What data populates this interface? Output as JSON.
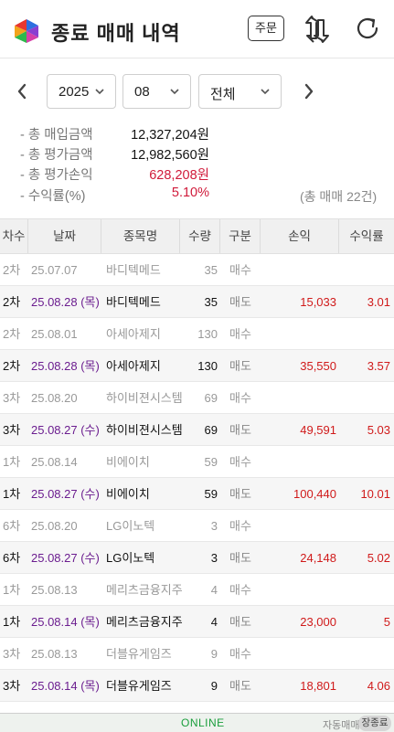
{
  "header": {
    "title": "종료 매매 내역",
    "order_label": "주문",
    "icons": {
      "logo": "app-logo",
      "swap": "swap-arrows-icon",
      "refresh": "refresh-icon"
    },
    "logo_colors": [
      "#e8372f",
      "#2d6fe0",
      "#8a3fd1",
      "#2db84c"
    ]
  },
  "filters": {
    "year": "2025",
    "month": "08",
    "type": "전체"
  },
  "summary": {
    "buy_total_label": "- 총 매입금액",
    "buy_total_value": "12,327,204원",
    "eval_total_label": "- 총 평가금액",
    "eval_total_value": "12,982,560원",
    "pl_total_label": "- 총 평가손익",
    "pl_total_value": "628,208원",
    "return_label": "- 수익률(%)",
    "return_value": "5.10%",
    "trade_count": "(총 매매 22건)"
  },
  "table": {
    "headers": [
      "차수",
      "날짜",
      "종목명",
      "수량",
      "구분",
      "손익",
      "수익률"
    ],
    "rows": [
      {
        "kind": "buy",
        "cha": "2차",
        "date": "25.07.07",
        "name": "바디텍메드",
        "qty": "35",
        "type": "매수",
        "pl": "",
        "rate": ""
      },
      {
        "kind": "sell",
        "cha": "2차",
        "date": "25.08.28 (목)",
        "name": "바디텍메드",
        "qty": "35",
        "type": "매도",
        "pl": "15,033",
        "rate": "3.01"
      },
      {
        "kind": "buy",
        "cha": "2차",
        "date": "25.08.01",
        "name": "아세아제지",
        "qty": "130",
        "type": "매수",
        "pl": "",
        "rate": ""
      },
      {
        "kind": "sell",
        "cha": "2차",
        "date": "25.08.28 (목)",
        "name": "아세아제지",
        "qty": "130",
        "type": "매도",
        "pl": "35,550",
        "rate": "3.57"
      },
      {
        "kind": "buy",
        "cha": "3차",
        "date": "25.08.20",
        "name": "하이비젼시스템",
        "qty": "69",
        "type": "매수",
        "pl": "",
        "rate": ""
      },
      {
        "kind": "sell",
        "cha": "3차",
        "date": "25.08.27 (수)",
        "name": "하이비젼시스템",
        "qty": "69",
        "type": "매도",
        "pl": "49,591",
        "rate": "5.03"
      },
      {
        "kind": "buy",
        "cha": "1차",
        "date": "25.08.14",
        "name": "비에이치",
        "qty": "59",
        "type": "매수",
        "pl": "",
        "rate": ""
      },
      {
        "kind": "sell",
        "cha": "1차",
        "date": "25.08.27 (수)",
        "name": "비에이치",
        "qty": "59",
        "type": "매도",
        "pl": "100,440",
        "rate": "10.01"
      },
      {
        "kind": "buy",
        "cha": "6차",
        "date": "25.08.20",
        "name": "LG이노텍",
        "qty": "3",
        "type": "매수",
        "pl": "",
        "rate": ""
      },
      {
        "kind": "sell",
        "cha": "6차",
        "date": "25.08.27 (수)",
        "name": "LG이노텍",
        "qty": "3",
        "type": "매도",
        "pl": "24,148",
        "rate": "5.02"
      },
      {
        "kind": "buy",
        "cha": "1차",
        "date": "25.08.13",
        "name": "메리츠금융지주",
        "qty": "4",
        "type": "매수",
        "pl": "",
        "rate": ""
      },
      {
        "kind": "sell",
        "cha": "1차",
        "date": "25.08.14 (목)",
        "name": "메리츠금융지주",
        "qty": "4",
        "type": "매도",
        "pl": "23,000",
        "rate": "5"
      },
      {
        "kind": "buy",
        "cha": "3차",
        "date": "25.08.13",
        "name": "더블유게임즈",
        "qty": "9",
        "type": "매수",
        "pl": "",
        "rate": ""
      },
      {
        "kind": "sell",
        "cha": "3차",
        "date": "25.08.14 (목)",
        "name": "더블유게임즈",
        "qty": "9",
        "type": "매도",
        "pl": "18,801",
        "rate": "4.06"
      }
    ]
  },
  "footer": {
    "status": "ONLINE",
    "auto_trade_label": "자동매매",
    "close_label": "장종료"
  }
}
